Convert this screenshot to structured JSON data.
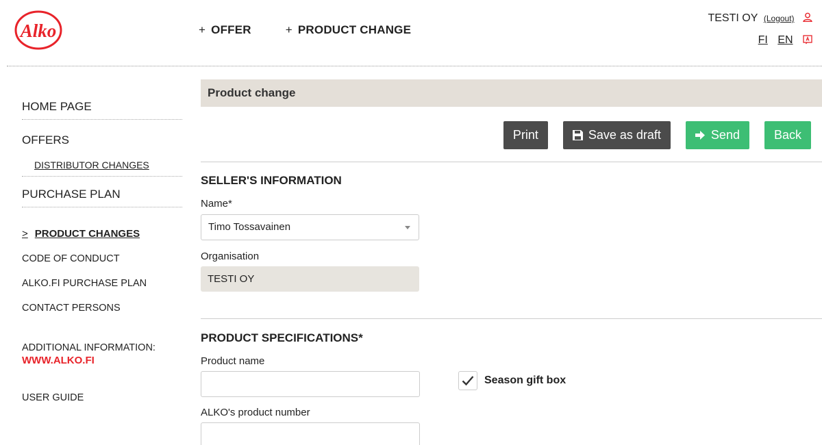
{
  "brand": {
    "logo_text": "Alko",
    "accent": "#e8232a"
  },
  "topnav": [
    {
      "plus": "+",
      "label": "OFFER"
    },
    {
      "plus": "+",
      "label": "PRODUCT CHANGE"
    }
  ],
  "account": {
    "company": "TESTI OY",
    "logout": "(Logout)",
    "lang_fi": "FI",
    "lang_en": "EN"
  },
  "sidebar": {
    "home": "HOME PAGE",
    "offers": "OFFERS",
    "distributor_changes": "DISTRIBUTOR CHANGES",
    "purchase_plan": "PURCHASE PLAN",
    "active_chev": ">",
    "product_changes": "PRODUCT CHANGES",
    "code_of_conduct": "CODE OF CONDUCT",
    "alko_purchase_plan": "ALKO.FI PURCHASE PLAN",
    "contact_persons": "CONTACT PERSONS",
    "additional_info": "ADDITIONAL INFORMATION:",
    "alko_link": "WWW.ALKO.FI",
    "user_guide": "USER GUIDE"
  },
  "main": {
    "title": "Product change",
    "buttons": {
      "print": "Print",
      "save_draft": "Save as draft",
      "send": "Send",
      "back": "Back"
    },
    "seller": {
      "heading": "SELLER'S INFORMATION",
      "name_label": "Name*",
      "name_value": "Timo Tossavainen",
      "org_label": "Organisation",
      "org_value": "TESTI OY"
    },
    "specs": {
      "heading": "PRODUCT SPECIFICATIONS*",
      "product_name_label": "Product name",
      "product_name_value": "",
      "season_gift_box": "Season gift box",
      "season_gift_box_checked": true,
      "product_number_label": "ALKO's product number",
      "product_number_value": ""
    }
  },
  "colors": {
    "green": "#3dbe74",
    "dark_button": "#4b4b4b",
    "section_bg": "#e4dfd8",
    "readonly_bg": "#e7e4de"
  }
}
